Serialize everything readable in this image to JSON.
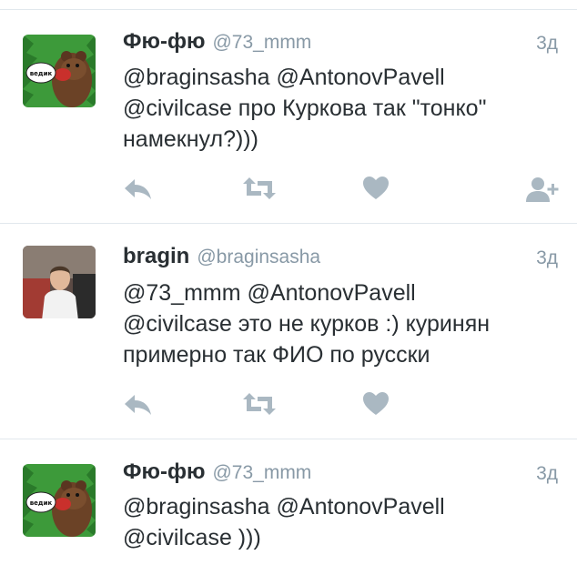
{
  "colors": {
    "text": "#292f33",
    "muted": "#8899a6",
    "icon": "#aab8c2",
    "divider": "#e1e8ed",
    "meme_green": "#3d9a3a"
  },
  "meme_avatar": {
    "sign_text": "ведик"
  },
  "tweets": [
    {
      "name": "Фю-фю",
      "handle": "@73_mmm",
      "time": "3д",
      "text": "@braginsasha @AntonovPavell\n@civilcase про Куркова так \"тонко\"\nнамекнул?)))",
      "actions": [
        "reply-icon",
        "retweet-icon",
        "like-icon",
        "follow-icon"
      ]
    },
    {
      "name": "bragin",
      "handle": "@braginsasha",
      "time": "3д",
      "text": "@73_mmm @AntonovPavell\n@civilcase это не курков :) куринян\nпримерно так ФИО по русски",
      "actions": [
        "reply-icon",
        "retweet-icon",
        "like-icon"
      ]
    },
    {
      "name": "Фю-фю",
      "handle": "@73_mmm",
      "time": "3д",
      "text": "@braginsasha @AntonovPavell\n@civilcase )))",
      "actions": []
    }
  ]
}
